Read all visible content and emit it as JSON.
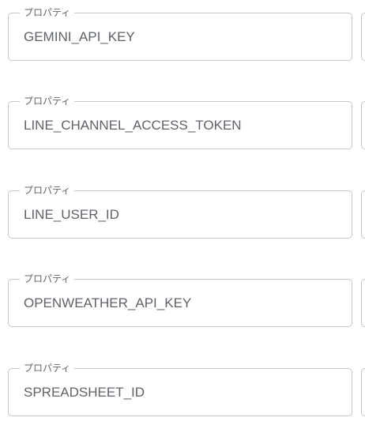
{
  "properties": [
    {
      "label": "プロパティ",
      "value": "GEMINI_API_KEY"
    },
    {
      "label": "プロパティ",
      "value": "LINE_CHANNEL_ACCESS_TOKEN"
    },
    {
      "label": "プロパティ",
      "value": "LINE_USER_ID"
    },
    {
      "label": "プロパティ",
      "value": "OPENWEATHER_API_KEY"
    },
    {
      "label": "プロパティ",
      "value": "SPREADSHEET_ID"
    }
  ]
}
